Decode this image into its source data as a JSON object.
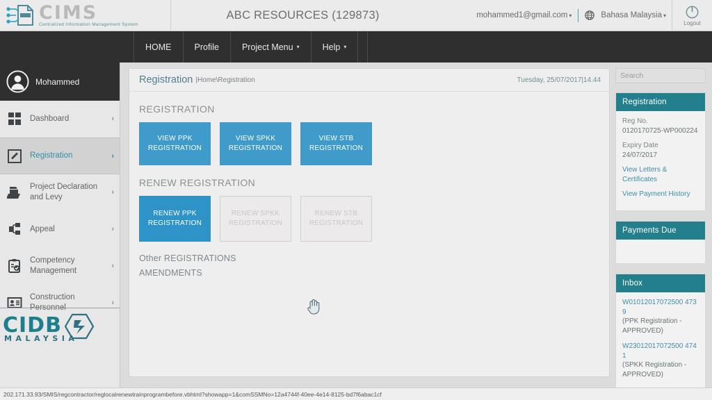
{
  "header": {
    "logo_name": "CIMS",
    "logo_tagline": "Centralized Information Management System",
    "logo_icon": "cims-network-document-icon",
    "company_title": "ABC RESOURCES (129873)",
    "account_email": "mohammed1@gmail.com",
    "account_caret": "▾",
    "globe_icon": "globe-icon",
    "language": "Bahasa Malaysia",
    "language_caret": "▾",
    "logout_label": "Logout",
    "logout_icon": "power-icon"
  },
  "nav": {
    "items": [
      {
        "label": "HOME",
        "caret": ""
      },
      {
        "label": "Profile",
        "caret": ""
      },
      {
        "label": "Project Menu",
        "caret": "▾"
      },
      {
        "label": "Help",
        "caret": "▾"
      }
    ]
  },
  "sidebar": {
    "user_name": "Mohammed",
    "avatar_icon": "user-avatar-icon",
    "chevron": "›",
    "items": [
      {
        "label": "Dashboard",
        "icon": "grid-dashboard-icon",
        "active": false
      },
      {
        "label": "Registration",
        "icon": "pencil-square-icon",
        "active": true
      },
      {
        "label": "Project Declaration and Levy",
        "icon": "folder-printer-icon",
        "active": false
      },
      {
        "label": "Appeal",
        "icon": "hierarchy-tree-icon",
        "active": false
      },
      {
        "label": "Competency Management",
        "icon": "clipboard-check-icon",
        "active": false
      },
      {
        "label": "Construction Personnel",
        "icon": "id-card-icon",
        "active": false
      }
    ],
    "footer_logo": "CIDB",
    "footer_logo_sub": "MALAYSIA",
    "footer_logo_icon": "cidb-hexagon-icon"
  },
  "breadcrumb": {
    "title": "Registration",
    "path": "|Home\\Registration",
    "datetime": "Tuesday, 25/07/2017|14.44"
  },
  "main": {
    "registration_section_title": "REGISTRATION",
    "registration_tiles": [
      {
        "label": "VIEW PPK REGISTRATION",
        "state": "enabled"
      },
      {
        "label": "VIEW SPKK REGISTRATION",
        "state": "enabled"
      },
      {
        "label": "VIEW STB REGISTRATION",
        "state": "enabled"
      }
    ],
    "renew_section_title": "RENEW REGISTRATION",
    "renew_tiles": [
      {
        "label": "RENEW PPK REGISTRATION",
        "state": "enabled"
      },
      {
        "label": "RENEW SPKK REGISTRATION",
        "state": "disabled"
      },
      {
        "label": "RENEW STB REGISTRATION",
        "state": "disabled"
      }
    ],
    "links": [
      {
        "label": "Other REGISTRATIONS"
      },
      {
        "label": "AMENDMENTS"
      }
    ]
  },
  "rail": {
    "search_placeholder": "Search",
    "search_value": "",
    "search_icon": "search-icon",
    "registration_panel": {
      "title": "Registration",
      "reg_no_label": "Reg No.",
      "reg_no_value": "0120170725-WP000224",
      "expiry_label": "Expiry Date",
      "expiry_value": "24/07/2017",
      "links": [
        {
          "label": "View Letters & Certificates"
        },
        {
          "label": "View Payment History"
        }
      ]
    },
    "payments_panel": {
      "title": "Payments Due"
    },
    "inbox_panel": {
      "title": "Inbox",
      "items": [
        {
          "id": "W01012017072500 4739",
          "desc": "(PPK Registration - APPROVED)"
        },
        {
          "id": "W23012017072500 4741",
          "desc": "(SPKK Registration - APPROVED)"
        }
      ]
    }
  },
  "statusbar": {
    "url": "202.171.33.93/SMIS/regcontractor/reglocalrenewtrainprogrambefore.vbhtml?showapp=1&comSSMNo=12a4744f-40ee-4e14-8125-bd7f6abac1cf"
  },
  "colors": {
    "tile_blue": "#3f9bc9",
    "panel_teal": "#237f8c",
    "nav_dark": "#2f2f2f",
    "link_blue": "#3d8fa8"
  }
}
